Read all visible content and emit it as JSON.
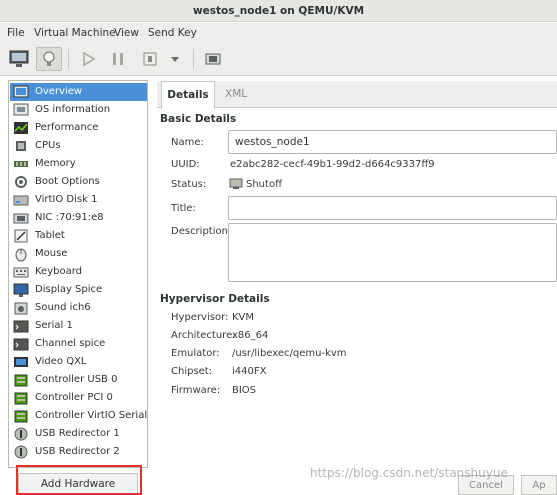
{
  "window": {
    "title": "westos_node1 on QEMU/KVM"
  },
  "menu": [
    "File",
    "Virtual Machine",
    "View",
    "Send Key"
  ],
  "toolbar": {
    "buttons": [
      "monitor-icon",
      "lightbulb-icon",
      "play-icon",
      "pause-icon",
      "power-icon",
      "dropdown-icon",
      "fullscreen-icon"
    ]
  },
  "sidebar": {
    "items": [
      {
        "label": "Overview",
        "icon": "overview-icon"
      },
      {
        "label": "OS information",
        "icon": "os-info-icon"
      },
      {
        "label": "Performance",
        "icon": "performance-icon"
      },
      {
        "label": "CPUs",
        "icon": "cpu-icon"
      },
      {
        "label": "Memory",
        "icon": "memory-icon"
      },
      {
        "label": "Boot Options",
        "icon": "boot-options-icon"
      },
      {
        "label": "VirtIO Disk 1",
        "icon": "disk-icon"
      },
      {
        "label": "NIC :70:91:e8",
        "icon": "nic-icon"
      },
      {
        "label": "Tablet",
        "icon": "tablet-icon"
      },
      {
        "label": "Mouse",
        "icon": "mouse-icon"
      },
      {
        "label": "Keyboard",
        "icon": "keyboard-icon"
      },
      {
        "label": "Display Spice",
        "icon": "display-icon"
      },
      {
        "label": "Sound ich6",
        "icon": "sound-icon"
      },
      {
        "label": "Serial 1",
        "icon": "serial-icon"
      },
      {
        "label": "Channel spice",
        "icon": "channel-icon"
      },
      {
        "label": "Video QXL",
        "icon": "video-icon"
      },
      {
        "label": "Controller USB 0",
        "icon": "controller-icon"
      },
      {
        "label": "Controller PCI 0",
        "icon": "controller-icon"
      },
      {
        "label": "Controller VirtIO Serial 0",
        "icon": "controller-icon"
      },
      {
        "label": "USB Redirector 1",
        "icon": "usb-redirector-icon"
      },
      {
        "label": "USB Redirector 2",
        "icon": "usb-redirector-icon"
      }
    ],
    "add_hardware_label": "Add Hardware"
  },
  "tabs": {
    "details": "Details",
    "xml": "XML"
  },
  "basic": {
    "heading": "Basic Details",
    "name_label": "Name:",
    "name_value": "westos_node1",
    "uuid_label": "UUID:",
    "uuid_value": "e2abc282-cecf-49b1-99d2-d664c9337ff9",
    "status_label": "Status:",
    "status_value": "Shutoff",
    "title_label": "Title:",
    "title_value": "",
    "description_label": "Description:",
    "description_value": ""
  },
  "hypervisor": {
    "heading": "Hypervisor Details",
    "hypervisor_label": "Hypervisor:",
    "hypervisor_value": "KVM",
    "architecture_label": "Architecture:",
    "architecture_value": "x86_64",
    "emulator_label": "Emulator:",
    "emulator_value": "/usr/libexec/qemu-kvm",
    "chipset_label": "Chipset:",
    "chipset_value": "i440FX",
    "firmware_label": "Firmware:",
    "firmware_value": "BIOS"
  },
  "footer": {
    "cancel_label": "Cancel",
    "apply_label": "Ap"
  },
  "watermark": "https://blog.csdn.net/stanshuyue",
  "colors": {
    "selection": "#4a90d9",
    "highlight_box": "#e0312a"
  }
}
